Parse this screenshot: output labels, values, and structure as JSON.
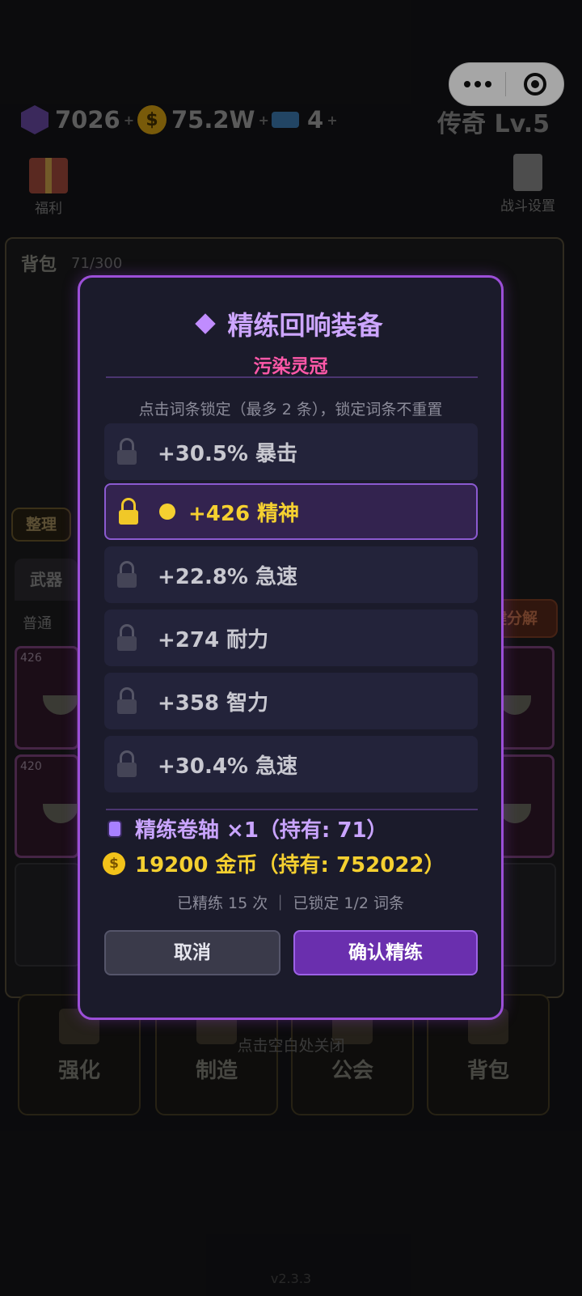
{
  "header": {
    "gems": "7026",
    "gold": "75.2W",
    "tickets": "4",
    "plus": "+",
    "rank": "传奇 Lv.5",
    "welfare_label": "福利",
    "battle_settings_label": "战斗设置"
  },
  "bag": {
    "title": "背包",
    "count": "71/300",
    "sort_label": "整理",
    "tab_weapon": "武器",
    "filter_common": "普通",
    "decompose_label": "键分解",
    "slot_levels": [
      "426",
      "420"
    ]
  },
  "bottom_nav": [
    "强化",
    "制造",
    "公会",
    "背包"
  ],
  "close_hint": "点击空白处关闭",
  "version": "v2.3.3",
  "modal": {
    "title": "精练回响装备",
    "item_name": "污染灵冠",
    "hint": "点击词条锁定（最多 2 条），锁定词条不重置",
    "affixes": [
      {
        "text": "+30.5% 暴击",
        "locked": false
      },
      {
        "text": "+426 精神",
        "locked": true
      },
      {
        "text": "+22.8% 急速",
        "locked": false
      },
      {
        "text": "+274 耐力",
        "locked": false
      },
      {
        "text": "+358 智力",
        "locked": false
      },
      {
        "text": "+30.4% 急速",
        "locked": false
      }
    ],
    "cost_scroll": "精练卷轴 ×1（持有: 71）",
    "cost_gold": "19200 金币（持有: 752022）",
    "stats": "已精练 15 次 ｜ 已锁定 1/2 词条",
    "cancel_label": "取消",
    "confirm_label": "确认精练",
    "coin_glyph": "$"
  },
  "colors": {
    "accent_purple": "#9c4fd8",
    "item_pink": "#ff58a8",
    "locked_gold": "#f5d030"
  }
}
